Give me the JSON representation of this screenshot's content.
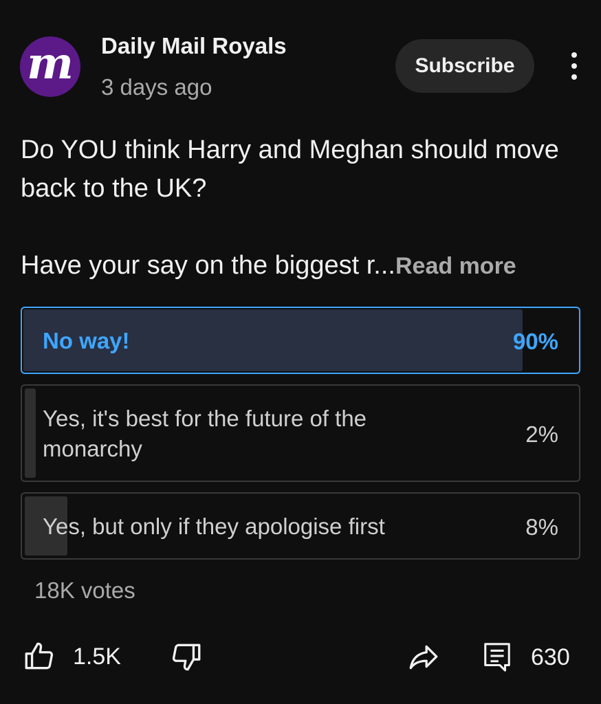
{
  "channel": {
    "name": "Daily Mail Royals",
    "time": "3 days ago",
    "avatar_letter": "m",
    "avatar_color": "#5b1a88"
  },
  "header": {
    "subscribe_label": "Subscribe",
    "menu_icon": "more-vert-icon"
  },
  "post": {
    "line1": "Do YOU think Harry and Meghan should move back to the UK?",
    "line2": "Have your say on the biggest r...",
    "read_more": "Read more"
  },
  "poll": {
    "options": [
      {
        "label": "No way!",
        "percent": "90%",
        "value": 90,
        "selected": true
      },
      {
        "label": "Yes, it's best for the future of the monarchy",
        "percent": "2%",
        "value": 2,
        "selected": false
      },
      {
        "label": "Yes, but only if they apologise first",
        "percent": "8%",
        "value": 8,
        "selected": false
      }
    ],
    "votes": "18K votes",
    "accent_color": "#3ea6ff"
  },
  "actions": {
    "like_count": "1.5K",
    "comment_count": "630",
    "icons": [
      "thumbs-up-icon",
      "thumbs-down-icon",
      "share-icon",
      "comment-icon"
    ]
  }
}
